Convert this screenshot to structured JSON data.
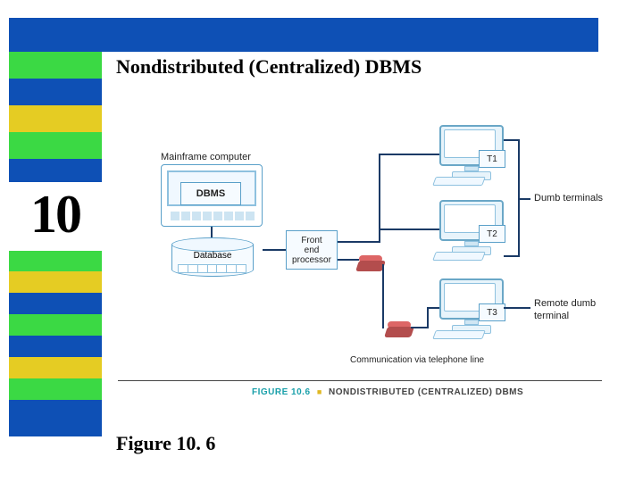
{
  "slide": {
    "chapter_number": "10",
    "title": "Nondistributed (Centralized) DBMS",
    "figure_label": "Figure 10. 6"
  },
  "diagram": {
    "mainframe_label": "Mainframe computer",
    "dbms_label": "DBMS",
    "database_label": "Database",
    "front_end_label": "Front\nend\nprocessor",
    "terminals": {
      "t1": "T1",
      "t2": "T2",
      "t3": "T3"
    },
    "right_labels": {
      "dumb": "Dumb terminals",
      "remote": "Remote dumb",
      "remote2": "terminal"
    },
    "comm_label": "Communication via telephone line",
    "caption_num": "FIGURE 10.6",
    "caption_text": "NONDISTRIBUTED (CENTRALIZED) DBMS"
  },
  "colors": {
    "blue": "#0e50b5",
    "green": "#3bd944",
    "yellow": "#e5cc23"
  }
}
